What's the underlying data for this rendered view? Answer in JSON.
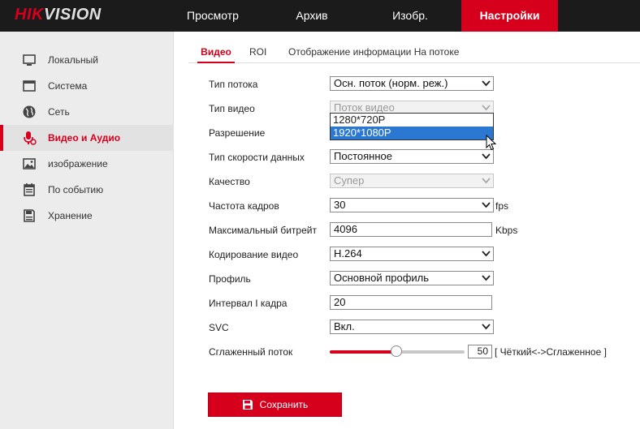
{
  "brand": {
    "logo_red": "HIK",
    "logo_rest": "VISION"
  },
  "topnav": {
    "items": [
      {
        "label": "Просмотр"
      },
      {
        "label": "Архив"
      },
      {
        "label": "Изобр."
      },
      {
        "label": "Настройки",
        "active": true
      }
    ]
  },
  "sidebar": {
    "items": [
      {
        "label": "Локальный",
        "icon": "monitor-icon"
      },
      {
        "label": "Система",
        "icon": "window-icon"
      },
      {
        "label": "Сеть",
        "icon": "globe-icon"
      },
      {
        "label": "Видео и Аудио",
        "icon": "microphone-icon",
        "active": true
      },
      {
        "label": "изображение",
        "icon": "image-icon"
      },
      {
        "label": "По событию",
        "icon": "calendar-icon"
      },
      {
        "label": "Хранение",
        "icon": "storage-icon"
      }
    ]
  },
  "tabs": [
    {
      "label": "Видео",
      "active": true
    },
    {
      "label": "ROI"
    },
    {
      "label": "Отображение информации На потоке"
    }
  ],
  "form": {
    "stream_type": {
      "label": "Тип потока",
      "value": "Осн. поток (норм. реж.)"
    },
    "video_type": {
      "label": "Тип видео",
      "value": "Поток видео"
    },
    "resolution": {
      "label": "Разрешение",
      "options": [
        "1280*720P",
        "1920*1080P"
      ],
      "highlighted": "1920*1080P"
    },
    "bitrate_type": {
      "label": "Тип скорости данных",
      "value": "Постоянное"
    },
    "quality": {
      "label": "Качество",
      "value": "Супер"
    },
    "frame_rate": {
      "label": "Частота кадров",
      "value": "30",
      "unit": "fps"
    },
    "max_bitrate": {
      "label": "Максимальный битрейт",
      "value": "4096",
      "unit": "Kbps"
    },
    "encoding": {
      "label": "Кодирование видео",
      "value": "H.264"
    },
    "profile": {
      "label": "Профиль",
      "value": "Основной профиль"
    },
    "iframe_interval": {
      "label": "Интервал I кадра",
      "value": "20"
    },
    "svc": {
      "label": "SVC",
      "value": "Вкл."
    },
    "smoothing": {
      "label": "Сглаженный поток",
      "value": "50",
      "range": [
        1,
        100
      ],
      "hint": "[ Чёткий<->Сглаженное ]"
    }
  },
  "actions": {
    "save_label": "Сохранить"
  },
  "colors": {
    "accent": "#d6001c",
    "highlight": "#2b78d2",
    "topbar": "#1b1b1b",
    "sidebar": "#ececec"
  }
}
